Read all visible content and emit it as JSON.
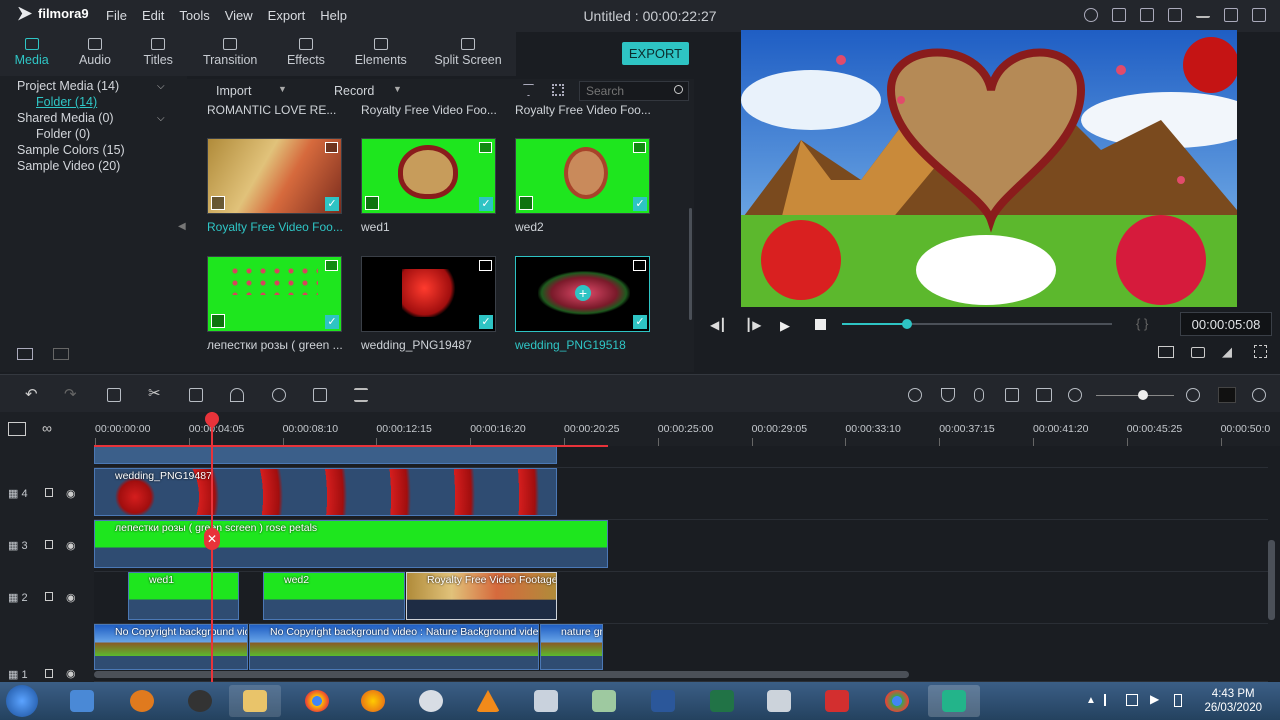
{
  "app": {
    "name": "filmora9",
    "title": "Untitled : 00:00:22:27"
  },
  "menu": [
    "File",
    "Edit",
    "Tools",
    "View",
    "Export",
    "Help"
  ],
  "tabs": [
    {
      "label": "Media",
      "icon": "folder-icon",
      "active": true
    },
    {
      "label": "Audio",
      "icon": "music-note-icon"
    },
    {
      "label": "Titles",
      "icon": "text-icon"
    },
    {
      "label": "Transition",
      "icon": "transition-icon"
    },
    {
      "label": "Effects",
      "icon": "effects-icon"
    },
    {
      "label": "Elements",
      "icon": "image-icon"
    },
    {
      "label": "Split Screen",
      "icon": "split-screen-icon"
    }
  ],
  "export_label": "EXPORT",
  "tree": {
    "project_media": "Project Media (14)",
    "folder_1": "Folder (14)",
    "shared_media": "Shared Media (0)",
    "folder_2": "Folder (0)",
    "sample_colors": "Sample Colors (15)",
    "sample_video": "Sample Video (20)"
  },
  "media_bar": {
    "import": "Import",
    "record": "Record",
    "search_placeholder": "Search"
  },
  "media_top_labels": [
    "ROMANTIC LOVE RE...",
    "Royalty Free Video Foo...",
    "Royalty Free Video Foo..."
  ],
  "media": [
    {
      "label": "Royalty Free Video Foo...",
      "selected": true
    },
    {
      "label": "wed1"
    },
    {
      "label": "wed2"
    },
    {
      "label": "лепестки розы ( green ..."
    },
    {
      "label": "wedding_PNG19487"
    },
    {
      "label": "wedding_PNG19518",
      "selected": true
    }
  ],
  "preview": {
    "timecode": "00:00:05:08",
    "progress": 0.24,
    "brackets": "{ }"
  },
  "ruler": [
    "00:00:00:00",
    "00:00:04:05",
    "00:00:08:10",
    "00:00:12:15",
    "00:00:16:20",
    "00:00:20:25",
    "00:00:25:00",
    "00:00:29:05",
    "00:00:33:10",
    "00:00:37:15",
    "00:00:41:20",
    "00:00:45:25",
    "00:00:50:0"
  ],
  "tracks": [
    {
      "id": "4",
      "clips": [
        "wedding_PNG19487"
      ]
    },
    {
      "id": "3",
      "clips": [
        "лепестки розы ( green screen ) rose petals"
      ]
    },
    {
      "id": "2",
      "clips": [
        "wed1",
        "wed2",
        "Royalty Free Video Footage"
      ]
    },
    {
      "id": "1",
      "clips": [
        "No Copyright background vid",
        "No Copyright background video : Nature Background video",
        "nature gree"
      ]
    }
  ],
  "clock": {
    "time": "4:43 PM",
    "date": "26/03/2020"
  },
  "colors": {
    "accent": "#2ec4c4",
    "playhead": "#e8333a",
    "green_screen": "#1ee61e"
  }
}
